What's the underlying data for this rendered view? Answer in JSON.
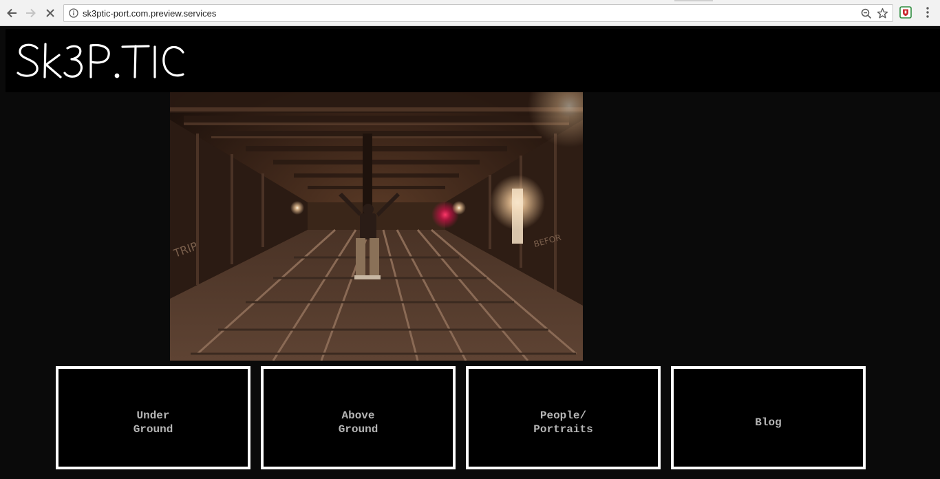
{
  "browser": {
    "url": "sk3ptic-port.com.preview.services",
    "icons": {
      "back": "arrow-left-icon",
      "forward": "arrow-right-icon",
      "stop": "close-icon",
      "info": "info-icon",
      "zoom": "zoom-out-icon",
      "bookmark": "star-icon",
      "extension": "shield-extension-icon",
      "menu": "vertical-dots-icon"
    }
  },
  "site": {
    "logo_text": "SK3P.TIC",
    "hero_alt": "Person standing on subway tracks in an underground tunnel",
    "nav_tiles": [
      {
        "label": "Under\nGround"
      },
      {
        "label": "Above\nGround"
      },
      {
        "label": "People/\nPortraits"
      },
      {
        "label": "Blog"
      }
    ]
  },
  "colors": {
    "page_bg": "#0a0a0a",
    "header_bg": "#000000",
    "tile_border": "#ffffff",
    "tile_text": "#b5b5b5",
    "logo": "#ffffff"
  }
}
